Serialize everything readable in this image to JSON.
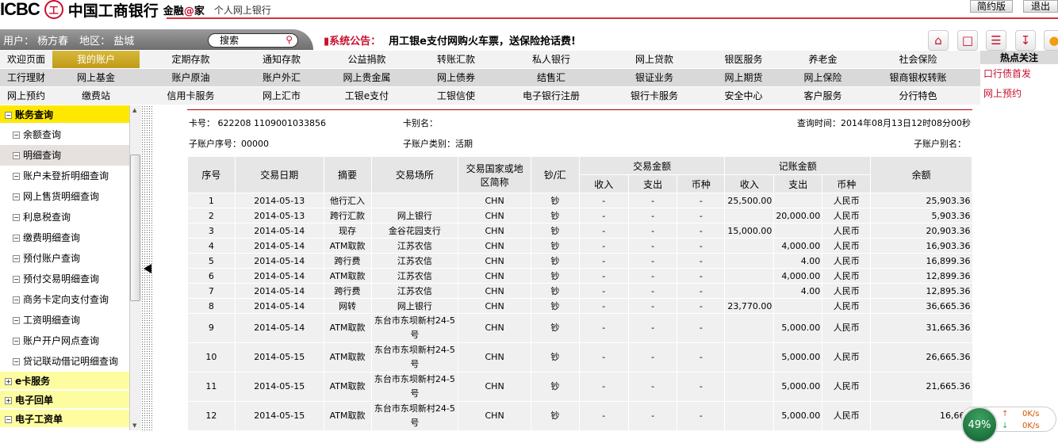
{
  "header": {
    "logo_en": "ICBC",
    "logo_seal": "工",
    "logo_cn": "中国工商银行",
    "slogan_a": "金融",
    "slogan_at": "@",
    "slogan_b": "家",
    "subtitle": "个人网上银行",
    "simple_btn": "简约版",
    "logout_btn": "退出"
  },
  "userbar": {
    "user": "用户：  杨方春",
    "region": "地区：  盐城",
    "search_placeholder": "搜索"
  },
  "notice": {
    "label": "系统公告：",
    "text": "用工银e支付网购火车票，送保险抢话费!"
  },
  "nav": {
    "row1": [
      "欢迎页面",
      "我的账户",
      "定期存款",
      "通知存款",
      "公益捐款",
      "转账汇款",
      "私人银行",
      "网上贷款",
      "银医服务",
      "养老金",
      "社会保险"
    ],
    "row2": [
      "工行理财",
      "网上基金",
      "账户原油",
      "账户外汇",
      "网上贵金属",
      "网上债券",
      "结售汇",
      "银证业务",
      "网上期货",
      "网上保险",
      "银商银权转账"
    ],
    "row3": [
      "网上预约",
      "缴费站",
      "信用卡服务",
      "网上汇市",
      "工银e支付",
      "工银信使",
      "电子银行注册",
      "银行卡服务",
      "安全中心",
      "客户服务",
      "分行特色"
    ]
  },
  "hot": {
    "title": "热点关注",
    "links": [
      "口行债首发",
      "网上预约"
    ]
  },
  "sidebar": {
    "group_open": "账务查询",
    "items": [
      "余额查询",
      "明细查询",
      "账户未登折明细查询",
      "网上售货明细查询",
      "利息税查询",
      "缴费明细查询",
      "预付账户查询",
      "预付交易明细查询",
      "商务卡定向支付查询",
      "工资明细查询",
      "账户开户网点查询",
      "贷记联动借记明细查询"
    ],
    "groups_closed": [
      "e卡服务",
      "电子回单",
      "电子工资单"
    ]
  },
  "info": {
    "card_label": "卡号：",
    "card_no": "622208 1109001033856",
    "alias_label": "卡别名：",
    "time_label": "查询时间：",
    "time": "2014年08月13日12时08分00秒",
    "sub_no_label": "子账户序号：",
    "sub_no": "00000",
    "sub_type_label": "子账户类别：",
    "sub_type": "活期",
    "sub_alias_label": "子账户别名："
  },
  "table": {
    "headers": {
      "seq": "序号",
      "date": "交易日期",
      "summary": "摘要",
      "place": "交易场所",
      "country": "交易国家或地区简称",
      "cash": "钞/汇",
      "trade_amt": "交易金额",
      "book_amt": "记账金额",
      "income": "收入",
      "expense": "支出",
      "currency": "币种",
      "balance": "余额"
    },
    "rows": [
      [
        "1",
        "2014-05-13",
        "他行汇入",
        "",
        "CHN",
        "钞",
        "-",
        "-",
        "-",
        "25,500.00",
        "",
        "人民币",
        "25,903.36"
      ],
      [
        "2",
        "2014-05-13",
        "跨行汇款",
        "网上银行",
        "CHN",
        "钞",
        "-",
        "-",
        "-",
        "",
        "20,000.00",
        "人民币",
        "5,903.36"
      ],
      [
        "3",
        "2014-05-14",
        "现存",
        "金谷花园支行",
        "CHN",
        "钞",
        "-",
        "-",
        "-",
        "15,000.00",
        "",
        "人民币",
        "20,903.36"
      ],
      [
        "4",
        "2014-05-14",
        "ATM取款",
        "江苏农信",
        "CHN",
        "钞",
        "-",
        "-",
        "-",
        "",
        "4,000.00",
        "人民币",
        "16,903.36"
      ],
      [
        "5",
        "2014-05-14",
        "跨行费",
        "江苏农信",
        "CHN",
        "钞",
        "-",
        "-",
        "-",
        "",
        "4.00",
        "人民币",
        "16,899.36"
      ],
      [
        "6",
        "2014-05-14",
        "ATM取款",
        "江苏农信",
        "CHN",
        "钞",
        "-",
        "-",
        "-",
        "",
        "4,000.00",
        "人民币",
        "12,899.36"
      ],
      [
        "7",
        "2014-05-14",
        "跨行费",
        "江苏农信",
        "CHN",
        "钞",
        "-",
        "-",
        "-",
        "",
        "4.00",
        "人民币",
        "12,895.36"
      ],
      [
        "8",
        "2014-05-14",
        "网转",
        "网上银行",
        "CHN",
        "钞",
        "-",
        "-",
        "-",
        "23,770.00",
        "",
        "人民币",
        "36,665.36"
      ],
      [
        "9",
        "2014-05-14",
        "ATM取款",
        "东台市东坝新村24-5号",
        "CHN",
        "钞",
        "-",
        "-",
        "-",
        "",
        "5,000.00",
        "人民币",
        "31,665.36"
      ],
      [
        "10",
        "2014-05-15",
        "ATM取款",
        "东台市东坝新村24-5号",
        "CHN",
        "钞",
        "-",
        "-",
        "-",
        "",
        "5,000.00",
        "人民币",
        "26,665.36"
      ],
      [
        "11",
        "2014-05-15",
        "ATM取款",
        "东台市东坝新村24-5号",
        "CHN",
        "钞",
        "-",
        "-",
        "-",
        "",
        "5,000.00",
        "人民币",
        "21,665.36"
      ],
      [
        "12",
        "2014-05-15",
        "ATM取款",
        "东台市东坝新村24-5号",
        "CHN",
        "钞",
        "-",
        "-",
        "-",
        "",
        "5,000.00",
        "人民币",
        "16,665"
      ]
    ]
  },
  "speed": {
    "percent": "49%",
    "up": "0K/s",
    "down": "0K/s"
  }
}
